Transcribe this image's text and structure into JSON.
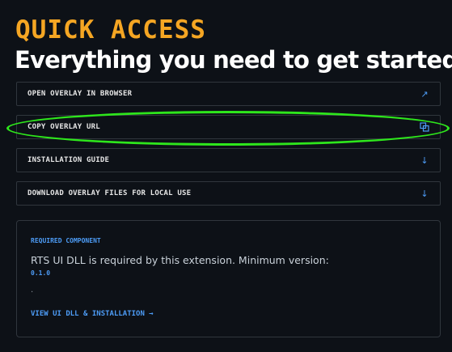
{
  "header": {
    "eyebrow": "QUICK ACCESS",
    "headline": "Everything you need to get started."
  },
  "actions": [
    {
      "label": "OPEN OVERLAY IN BROWSER",
      "icon": "external-link-icon",
      "glyph": "↗"
    },
    {
      "label": "COPY OVERLAY URL",
      "icon": "copy-icon",
      "glyph": ""
    },
    {
      "label": "INSTALLATION GUIDE",
      "icon": "arrow-down-icon",
      "glyph": "↓"
    },
    {
      "label": "DOWNLOAD OVERLAY FILES FOR LOCAL USE",
      "icon": "arrow-down-icon",
      "glyph": "↓"
    }
  ],
  "required": {
    "tag": "REQUIRED COMPONENT",
    "text": "RTS UI DLL is required by this extension. Minimum version:",
    "version": "0.1.0",
    "dot": ".",
    "link": "VIEW UI DLL & INSTALLATION →"
  },
  "colors": {
    "background": "#0d1117",
    "accent_orange": "#f5a623",
    "accent_blue": "#4d9cf6",
    "border": "#30363d",
    "highlight_green": "#2ee61c"
  }
}
